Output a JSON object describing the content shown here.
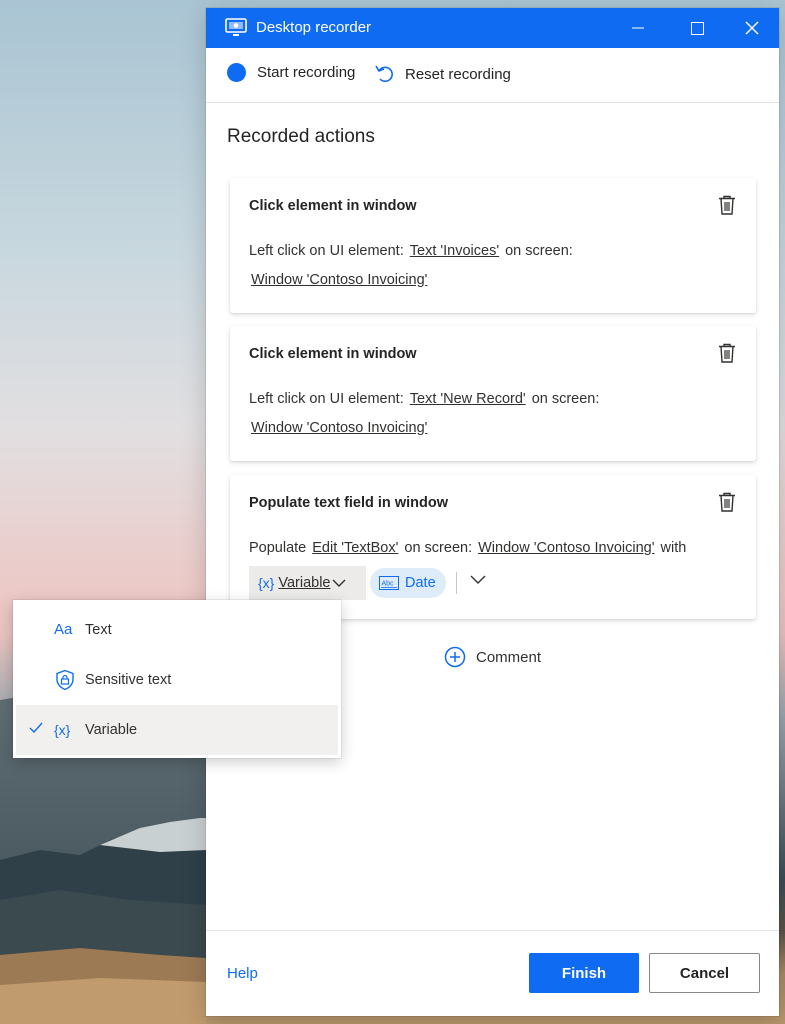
{
  "window": {
    "title": "Desktop recorder"
  },
  "toolbar": {
    "start_label": "Start recording",
    "reset_label": "Reset recording"
  },
  "heading": "Recorded actions",
  "actions": [
    {
      "title": "Click element in window",
      "prefix": "Left click on UI element:",
      "element": "Text 'Invoices'",
      "mid": "on screen:",
      "screen": "Window 'Contoso Invoicing'"
    },
    {
      "title": "Click element in window",
      "prefix": "Left click on UI element:",
      "element": "Text 'New Record'",
      "mid": "on screen:",
      "screen": "Window 'Contoso Invoicing'"
    },
    {
      "title": "Populate text field in window",
      "prefix": "Populate",
      "element": "Edit 'TextBox'",
      "mid": "on screen:",
      "screen": "Window 'Contoso Invoicing'",
      "suffix": "with",
      "variable_icon": "{x}",
      "variable_label": "Variable",
      "date_label": "Date"
    }
  ],
  "comment_label": "Comment",
  "footer": {
    "help_label": "Help",
    "finish_label": "Finish",
    "cancel_label": "Cancel"
  },
  "menu": {
    "items": [
      {
        "icon": "text-aa-icon",
        "icon_text": "Aa",
        "label": "Text",
        "selected": false
      },
      {
        "icon": "shield-lock-icon",
        "label": "Sensitive text",
        "selected": false
      },
      {
        "icon": "variable-icon",
        "icon_text": "{x}",
        "label": "Variable",
        "selected": true
      }
    ]
  },
  "colors": {
    "accent": "#0f6cf2",
    "selected_bg": "#f2f0ee",
    "date_chip_bg": "#deecf9"
  }
}
